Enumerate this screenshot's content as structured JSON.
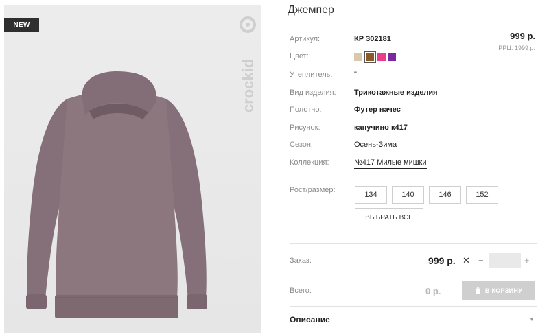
{
  "product": {
    "badge": "NEW",
    "brand_logo_text": "crockid",
    "title": "Джемпер",
    "price": "999 р.",
    "rrp": "РРЦ: 1999 р."
  },
  "specs": {
    "article_label": "Артикул:",
    "article_value": "КР 302181",
    "color_label": "Цвет:",
    "insulation_label": "Утеплитель:",
    "insulation_value": "\"",
    "type_label": "Вид изделия:",
    "type_value": "Трикотажные изделия",
    "fabric_label": "Полотно:",
    "fabric_value": "Футер начес",
    "pattern_label": "Рисунок:",
    "pattern_value": "капучино к417",
    "season_label": "Сезон:",
    "season_value": "Осень-Зима",
    "collection_label": "Коллекция:",
    "collection_value": "№417 Милые мишки"
  },
  "colors": [
    {
      "hex": "#d9c9ac",
      "selected": false
    },
    {
      "hex": "#8b5a2b",
      "selected": true
    },
    {
      "hex": "#e83e8c",
      "selected": false
    },
    {
      "hex": "#7a2a9c",
      "selected": false
    }
  ],
  "size": {
    "label": "Рост/размер:",
    "options": [
      "134",
      "140",
      "146",
      "152"
    ],
    "select_all": "ВЫБРАТЬ ВСЕ"
  },
  "order": {
    "label": "Заказ:",
    "price": "999 р.",
    "times": "✕",
    "minus": "−",
    "plus": "+",
    "quantity": ""
  },
  "total": {
    "label": "Всего:",
    "price": "0 р.",
    "cart_button": "В КОРЗИНУ"
  },
  "description": {
    "title": "Описание"
  },
  "colors_theme": {
    "accent_dark": "#2f2f2f",
    "muted_button": "#cfcfcf",
    "hoodie": "#8b757b"
  }
}
